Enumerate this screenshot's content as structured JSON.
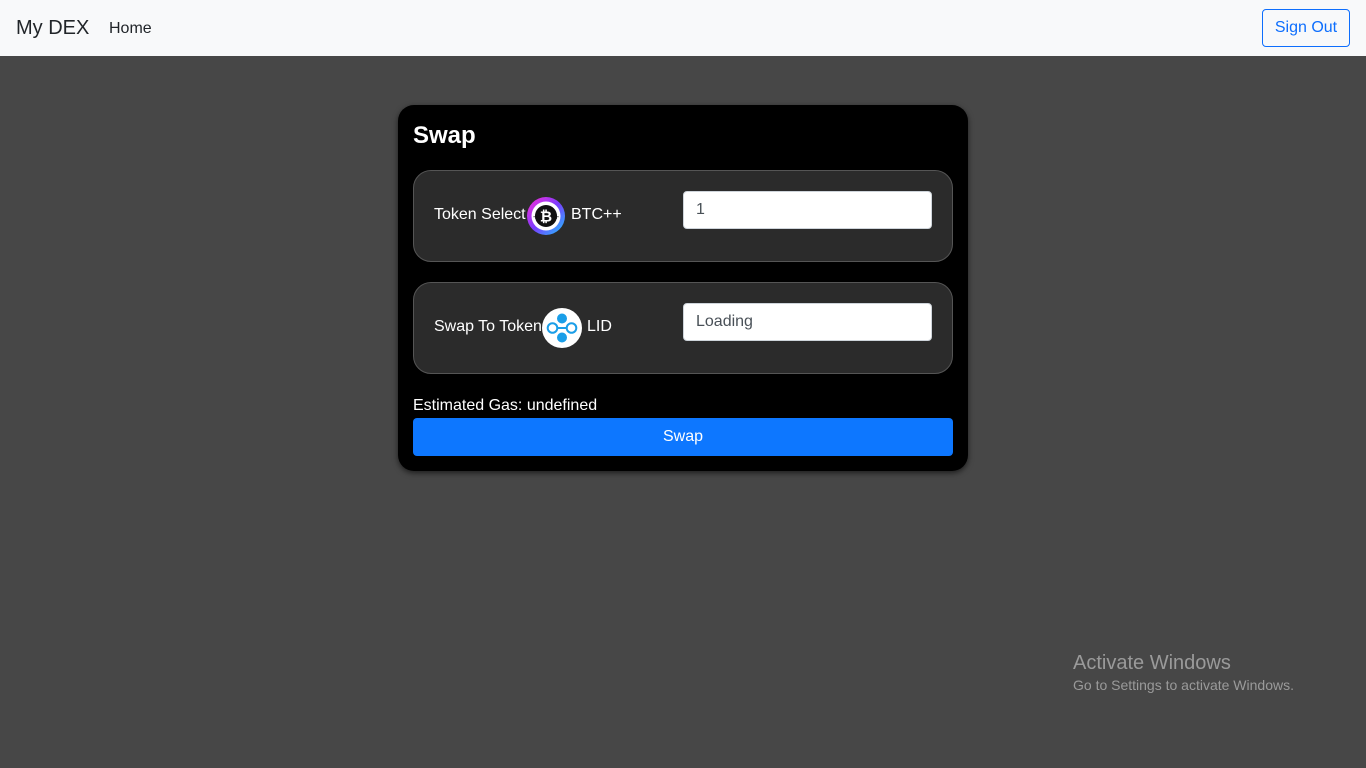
{
  "navbar": {
    "brand": "My DEX",
    "home_label": "Home",
    "signout_label": "Sign Out"
  },
  "swap": {
    "title": "Swap",
    "from": {
      "label": "Token Select",
      "token_icon": "btc-plus-icon",
      "token_name": "BTC++",
      "amount": "1"
    },
    "to": {
      "label": "Swap To Token",
      "token_icon": "lid-icon",
      "token_name": "LID",
      "amount": "Loading"
    },
    "estimated_gas": "Estimated Gas: undefined",
    "button_label": "Swap"
  },
  "watermark": {
    "title": "Activate Windows",
    "subtitle": "Go to Settings to activate Windows."
  },
  "colors": {
    "accent": "#0d77ff",
    "navbar_bg": "#f8f9fa",
    "page_bg": "#474747",
    "card_bg": "#000000",
    "row_bg": "#2b2b2b"
  }
}
